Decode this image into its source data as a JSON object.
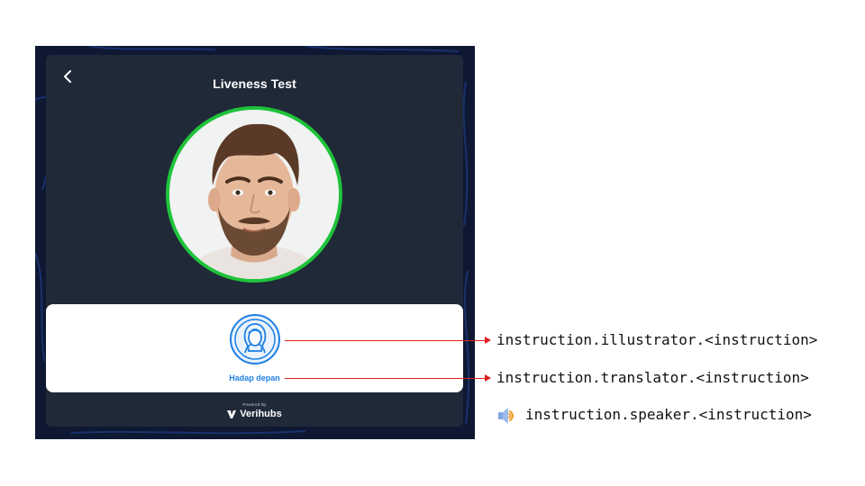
{
  "screen": {
    "title": "Liveness Test",
    "back_icon": "chevron-left-icon",
    "face_ring_color": "#1ec33a",
    "instruction_panel": {
      "illustration_icon": "face-front-icon",
      "text": "Hadap depan",
      "accent_color": "#1e7fe3"
    },
    "footer": {
      "powered_label": "Powered By",
      "brand": "Verihubs",
      "brand_icon": "verihubs-logo"
    }
  },
  "annotations": {
    "illustrator": "instruction.illustrator.<instruction>",
    "translator": "instruction.translator.<instruction>",
    "speaker": "instruction.speaker.<instruction>",
    "speaker_icon": "speaker-icon",
    "arrow_color": "#e02020"
  }
}
